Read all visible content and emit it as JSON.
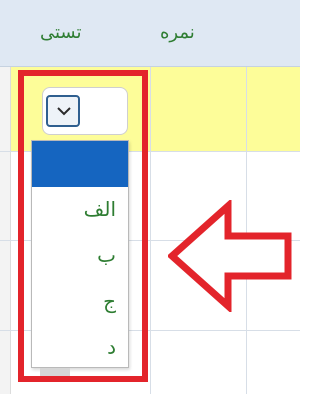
{
  "header": {
    "columns": [
      {
        "label": "تستی"
      },
      {
        "label": "نمره"
      }
    ]
  },
  "select": {
    "selected_value": "",
    "options": [
      "",
      "الف",
      "ب",
      "ج",
      "د"
    ]
  },
  "colors": {
    "header_bg": "#dfe8f3",
    "highlight_row": "#fdfd99",
    "label_green": "#2e7d32",
    "selected_option_bg": "#1565c0",
    "annotation_red": "#e3242b"
  },
  "icons": {
    "dropdown": "chevron-down-icon",
    "annotation": "arrow-left-icon"
  }
}
